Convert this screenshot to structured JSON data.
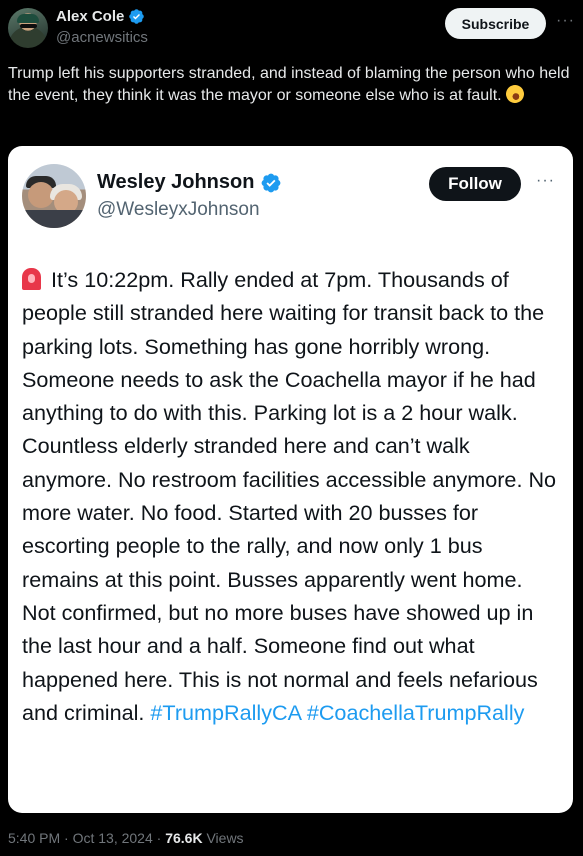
{
  "author": {
    "name": "Alex Cole",
    "handle": "@acnewsitics",
    "verified": true
  },
  "actions": {
    "subscribe_label": "Subscribe",
    "more_label": "···"
  },
  "tweet": {
    "text": "Trump left his supporters stranded, and instead of blaming the person who held the event, they think it was the mayor or someone else who is at fault.",
    "emoji": "rolling-on-floor-laughing-emoji"
  },
  "quoted": {
    "name": "Wesley Johnson",
    "handle": "@WesleyxJohnson",
    "verified": true,
    "follow_label": "Follow",
    "more_label": "···",
    "siren_emoji": "police-light-emoji",
    "body": "It’s 10:22pm. Rally ended at 7pm. Thousands of people still stranded here waiting for transit back to the parking lots. Something has gone horribly wrong. Someone needs to ask the Coachella mayor if he had anything to do with this. Parking lot is a 2 hour walk. Countless elderly stranded here and can’t walk anymore. No restroom facilities accessible anymore. No more water. No food. Started with 20 busses for escorting people to the rally, and now only 1 bus remains at this point. Busses apparently went home. Not confirmed, but no more buses have showed up in the last hour and a half. Someone find out what happened here. This is not normal and feels nefarious and criminal.",
    "hashtags": [
      "#TrumpRallyCA",
      "#CoachellaTrumpRally"
    ]
  },
  "meta": {
    "time": "5:40 PM",
    "separator": "·",
    "date": "Oct 13, 2024",
    "views_count": "76.6K",
    "views_label": "Views"
  },
  "colors": {
    "background": "#000000",
    "verified_blue": "#1d9bf0",
    "hashtag_blue": "#1d9bf0",
    "secondary_text": "#71767b"
  }
}
